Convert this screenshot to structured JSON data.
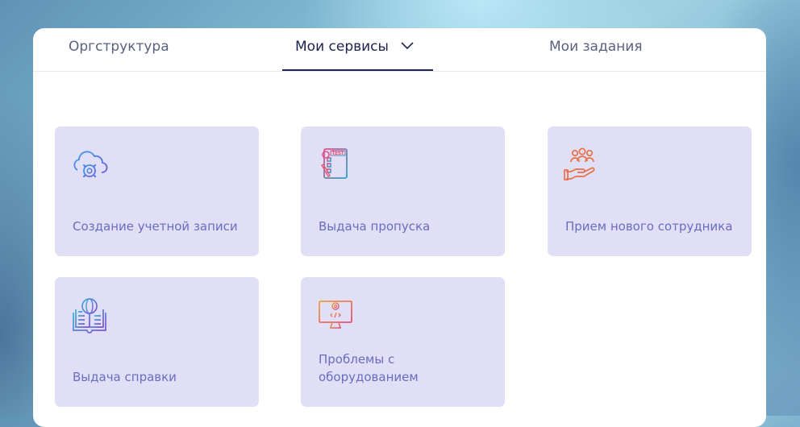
{
  "tabs": {
    "orgstructure": "Оргструктура",
    "my_services": "Мои сервисы",
    "my_tasks": "Мои задания"
  },
  "services": [
    {
      "label": "Создание учетной записи",
      "icon": "cloud-gear-icon"
    },
    {
      "label": "Выдача пропуска",
      "icon": "test-document-icon"
    },
    {
      "label": "Прием нового сотрудника",
      "icon": "hand-people-icon"
    },
    {
      "label": "Выдача справки",
      "icon": "book-globe-icon"
    },
    {
      "label": "Проблемы с оборудованием",
      "icon": "monitor-gear-icon"
    }
  ],
  "colors": {
    "card_bg": "#e0dff5",
    "label": "#6a6dbf",
    "active_tab": "#1d2250"
  }
}
